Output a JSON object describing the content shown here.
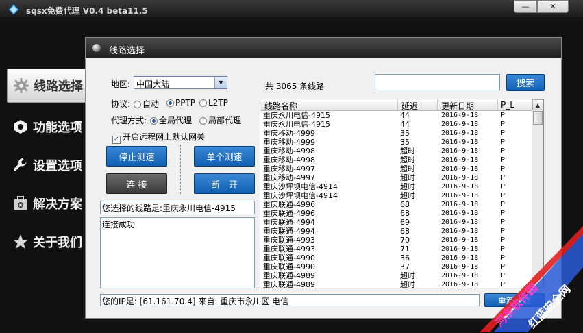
{
  "app": {
    "title": "sqsx免费代理 V0.4 beta11.5"
  },
  "window_buttons": {
    "minimize": "—",
    "close": "✕"
  },
  "sidebar": {
    "items": [
      {
        "label": "线路选择",
        "icon": "gear-icon",
        "active": true
      },
      {
        "label": "功能选项",
        "icon": "hexagon-icon",
        "active": false
      },
      {
        "label": "设置选项",
        "icon": "wrench-icon",
        "active": false
      },
      {
        "label": "解决方案",
        "icon": "toolbox-icon",
        "active": false
      },
      {
        "label": "关于我们",
        "icon": "star-icon",
        "active": false
      }
    ]
  },
  "panel": {
    "title": "线路选择",
    "region_label": "地区:",
    "region_value": "中国大陆",
    "protocol_label": "协议:",
    "protocol_options": [
      "自动",
      "PPTP",
      "L2TP"
    ],
    "protocol_selected": "PPTP",
    "proxy_mode_label": "代理方式:",
    "proxy_mode_options": [
      "全局代理",
      "局部代理"
    ],
    "proxy_mode_selected": "全局代理",
    "gateway_checkbox_label": "开启远程网上默认网关",
    "gateway_checked": true,
    "buttons": {
      "stop_test": "停止测速",
      "single_test": "单个测速",
      "connect": "连 接",
      "disconnect": "断　开",
      "search": "搜索",
      "refresh": "重新获取"
    },
    "selected_line_text": "您选择的线路是:重庆永川电信-4915",
    "log_text": "连接成功",
    "line_count_text": "共 3065 条线路",
    "ip_text": "您的IP是: [61.161.70.4] 来自: 重庆市永川区 电信",
    "search_value": ""
  },
  "table": {
    "columns": [
      "线路名称",
      "延迟",
      "更新日期",
      "P_L"
    ],
    "rows": [
      [
        "重庆永川电信-4915",
        "44",
        "2016-9-18",
        "P"
      ],
      [
        "重庆永川电信-4915",
        "44",
        "2016-9-18",
        "P"
      ],
      [
        "重庆移动-4999",
        "35",
        "2016-9-18",
        "P"
      ],
      [
        "重庆移动-4999",
        "35",
        "2016-9-18",
        "P"
      ],
      [
        "重庆移动-4998",
        "超时",
        "2016-9-18",
        "P"
      ],
      [
        "重庆移动-4998",
        "超时",
        "2016-9-18",
        "P"
      ],
      [
        "重庆移动-4997",
        "超时",
        "2016-9-18",
        "P"
      ],
      [
        "重庆移动-4997",
        "超时",
        "2016-9-18",
        "P"
      ],
      [
        "重庆沙坪坝电信-4914",
        "超时",
        "2016-9-18",
        "P"
      ],
      [
        "重庆沙坪坝电信-4914",
        "超时",
        "2016-9-18",
        "P"
      ],
      [
        "重庆联通-4996",
        "68",
        "2016-9-18",
        "P"
      ],
      [
        "重庆联通-4996",
        "68",
        "2016-9-18",
        "P"
      ],
      [
        "重庆联通-4994",
        "69",
        "2016-9-18",
        "P"
      ],
      [
        "重庆联通-4994",
        "68",
        "2016-9-18",
        "P"
      ],
      [
        "重庆联通-4993",
        "70",
        "2016-9-18",
        "P"
      ],
      [
        "重庆联通-4993",
        "71",
        "2016-9-18",
        "P"
      ],
      [
        "重庆联通-4990",
        "36",
        "2016-9-18",
        "P"
      ],
      [
        "重庆联通-4990",
        "37",
        "2016-9-18",
        "P"
      ],
      [
        "重庆联通-4989",
        "超时",
        "2016-9-18",
        "P"
      ],
      [
        "重庆联通-4989",
        "超时",
        "2016-9-18",
        "P"
      ]
    ]
  },
  "watermark": {
    "line1": "河东软件园",
    "line2": "红蓝安全网"
  },
  "colors": {
    "accent_blue": "#1a6fc4",
    "dark_bg": "#111111",
    "panel_bg": "#f0f0f0"
  }
}
